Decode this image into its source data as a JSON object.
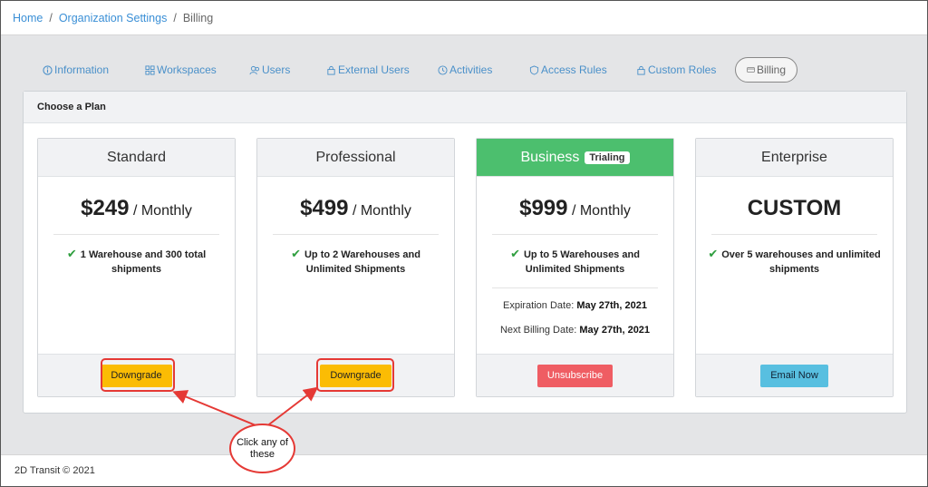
{
  "breadcrumb": {
    "home": "Home",
    "org_settings": "Organization Settings",
    "current": "Billing",
    "sep": "/"
  },
  "tabs": [
    {
      "label": "Information",
      "icon": "info-icon"
    },
    {
      "label": "Workspaces",
      "icon": "grid-icon"
    },
    {
      "label": "Users",
      "icon": "users-icon"
    },
    {
      "label": "External Users",
      "icon": "lock-icon"
    },
    {
      "label": "Activities",
      "icon": "clock-icon"
    },
    {
      "label": "Access Rules",
      "icon": "shield-icon"
    },
    {
      "label": "Custom Roles",
      "icon": "lock-icon"
    },
    {
      "label": "Billing",
      "icon": "credit-card-icon",
      "active": true
    }
  ],
  "panel": {
    "title": "Choose a Plan"
  },
  "plans": [
    {
      "name": "Standard",
      "price": "$249",
      "period": "/ Monthly",
      "feature": "1 Warehouse and 300 total shipments",
      "button": "Downgrade"
    },
    {
      "name": "Professional",
      "price": "$499",
      "period": "/ Monthly",
      "feature": "Up to 2 Warehouses and Unlimited Shipments",
      "button": "Downgrade"
    },
    {
      "name": "Business",
      "badge": "Trialing",
      "price": "$999",
      "period": "/ Monthly",
      "feature": "Up to 5 Warehouses and Unlimited Shipments",
      "expiration_label": "Expiration Date:",
      "expiration_value": "May 27th, 2021",
      "next_billing_label": "Next Billing Date:",
      "next_billing_value": "May 27th, 2021",
      "button": "Unsubscribe"
    },
    {
      "name": "Enterprise",
      "price": "CUSTOM",
      "feature": "Over 5 warehouses and unlimited shipments",
      "button": "Email Now"
    }
  ],
  "annotation": {
    "callout": "Click any of these"
  },
  "footer": {
    "text": "2D Transit © 2021"
  },
  "colors": {
    "accent_green": "#4cbf6e",
    "link_blue": "#3a8fd6",
    "warning": "#fbbc04",
    "danger": "#ef5d63",
    "info": "#58bfe0",
    "annotation_red": "#e53935"
  }
}
